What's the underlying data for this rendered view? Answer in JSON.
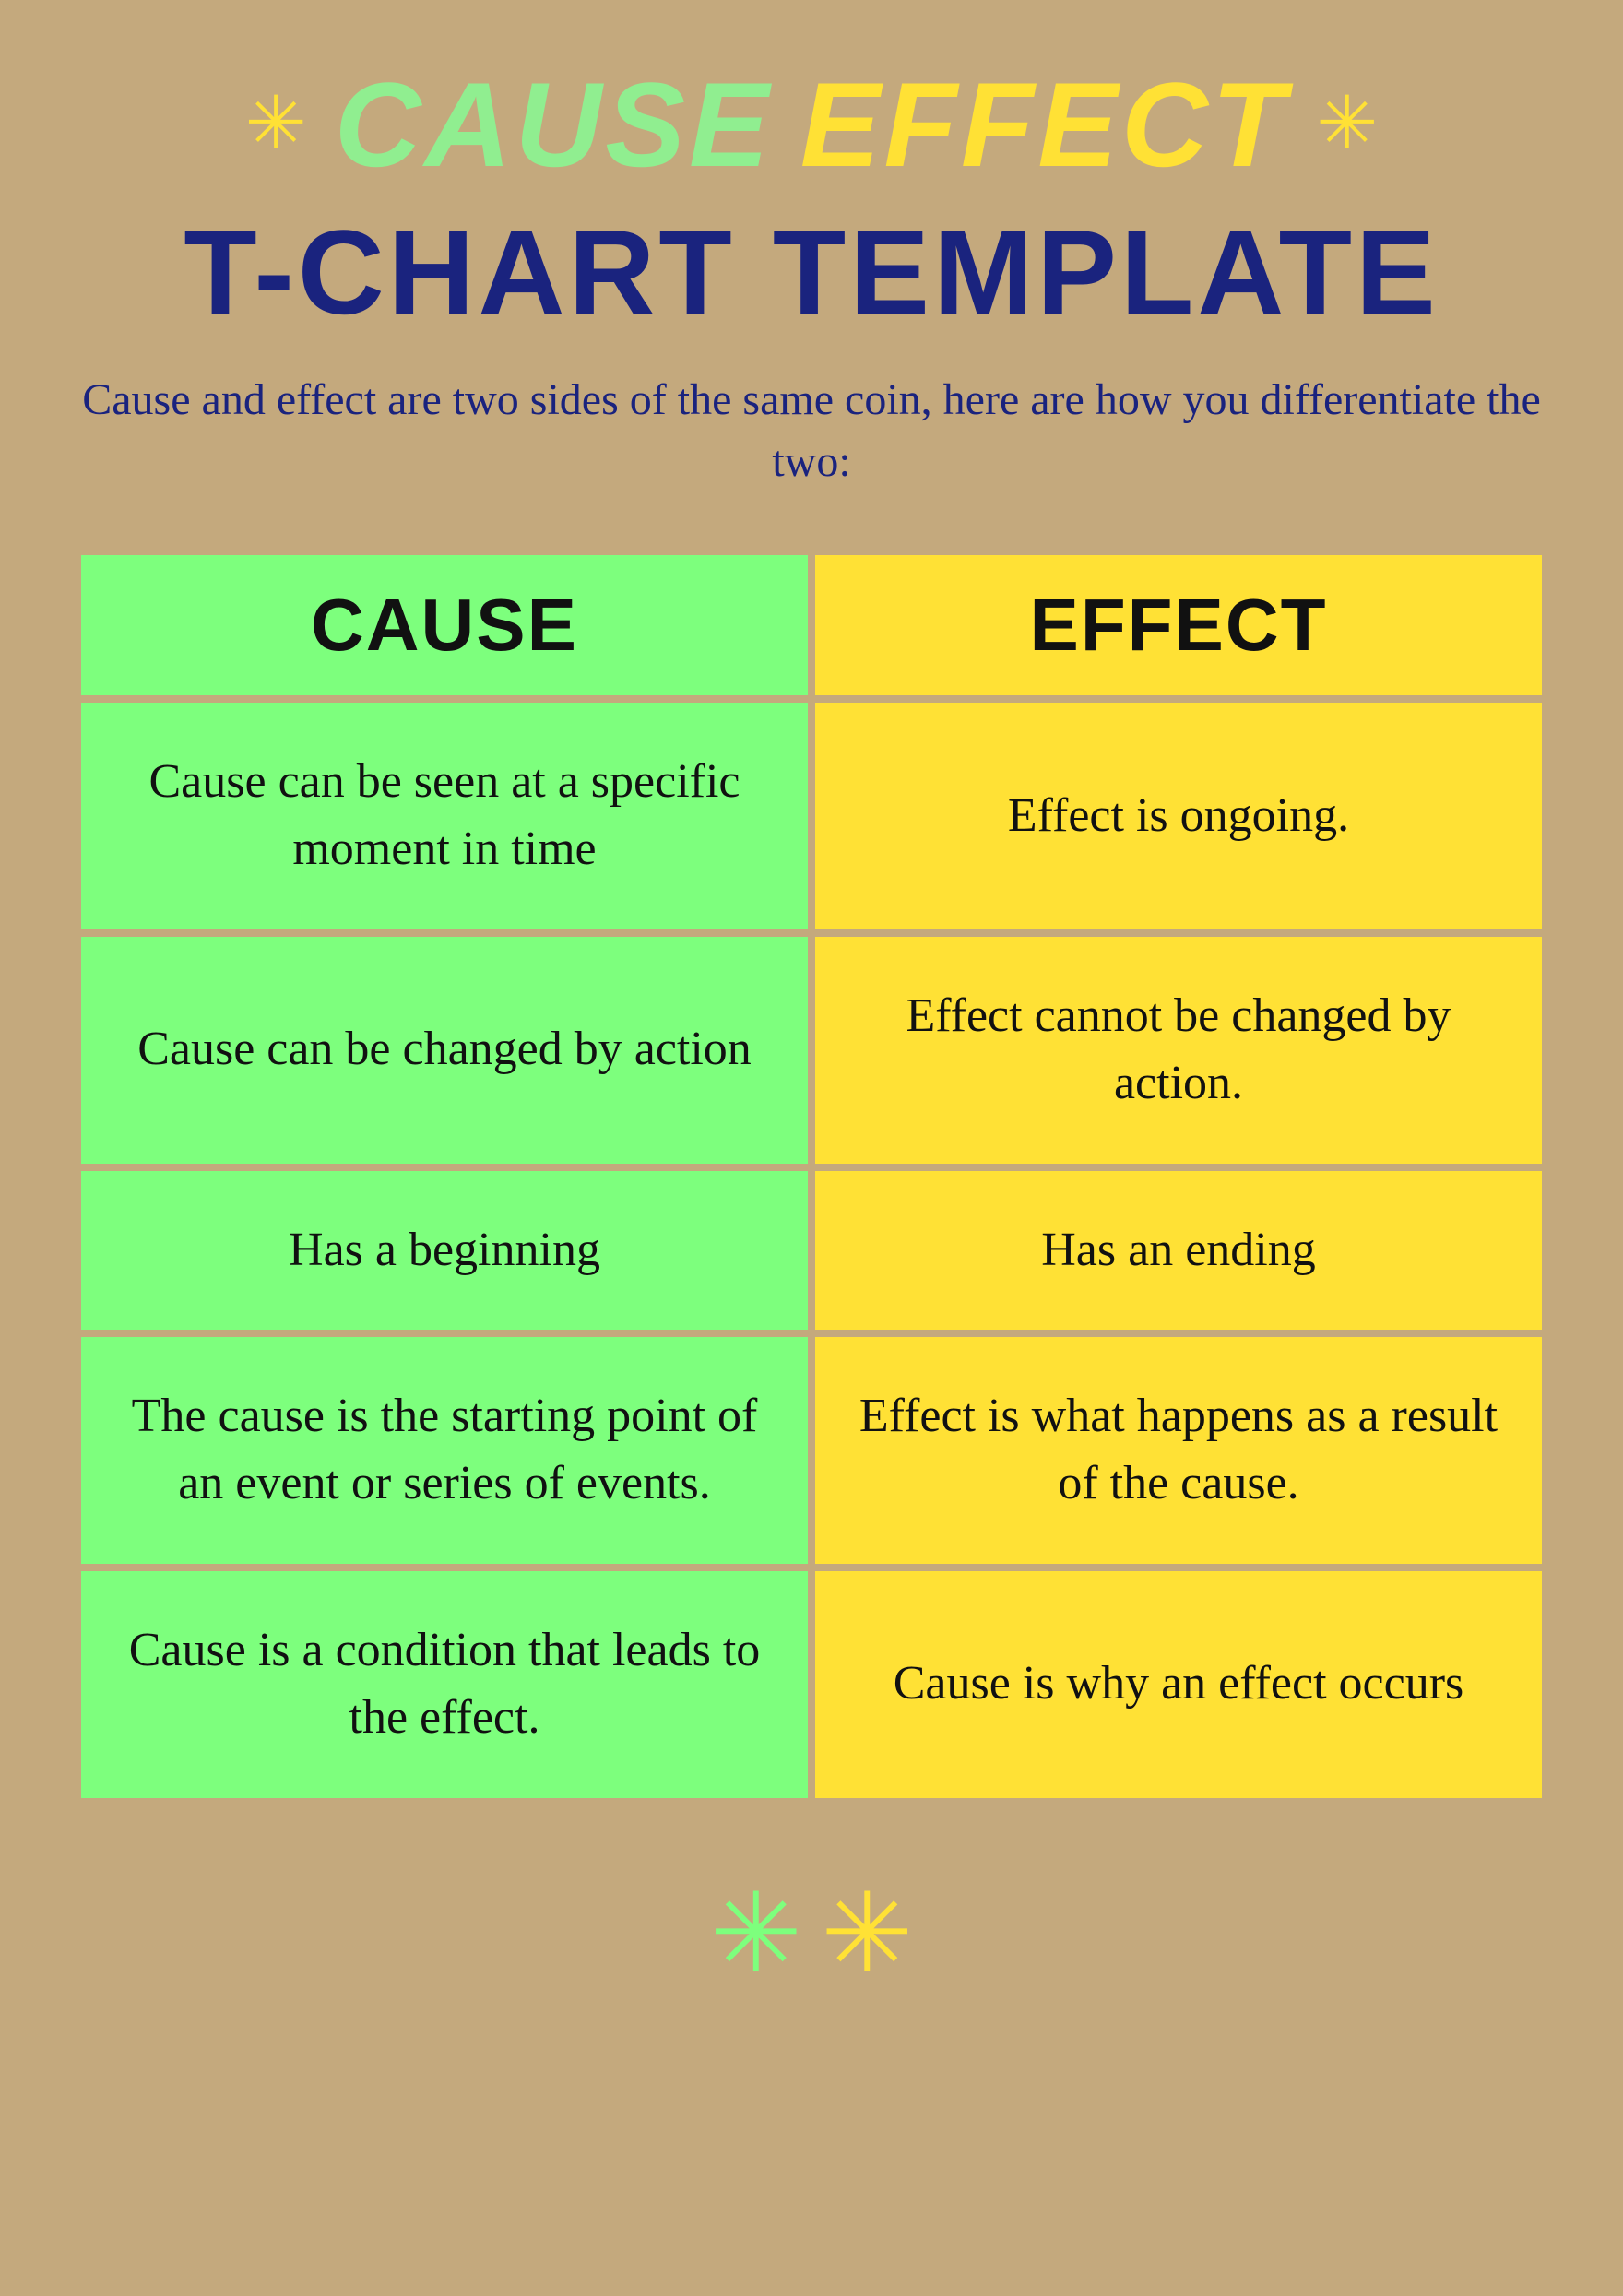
{
  "header": {
    "title_cause": "CAUSE",
    "title_effect": "EFFECT",
    "title_line2": "T-CHART TEMPLATE",
    "subtitle": "Cause and effect are two sides of the same coin, here are how you differentiate the two:",
    "star_symbol": "✳"
  },
  "table": {
    "col_cause_header": "CAUSE",
    "col_effect_header": "EFFECT",
    "rows": [
      {
        "cause": "Cause can be seen at a specific moment in time",
        "effect": "Effect is ongoing."
      },
      {
        "cause": "Cause can be changed by action",
        "effect": "Effect cannot be changed by action."
      },
      {
        "cause": "Has a beginning",
        "effect": "Has an ending"
      },
      {
        "cause": "The cause is the starting point of an event or series of events.",
        "effect": "Effect is what happens as a result of the cause."
      },
      {
        "cause": "Cause is a condition that leads to the effect.",
        "effect": "Cause is why an effect occurs"
      }
    ]
  },
  "colors": {
    "background": "#C4A97D",
    "cause_bg": "#7DFF7D",
    "effect_bg": "#FFE135",
    "title_cause_color": "#90EE90",
    "title_effect_color": "#FFE135",
    "title_line2_color": "#1a237e",
    "subtitle_color": "#1a237e",
    "star_color_yellow": "#FFE135",
    "star_color_green": "#7DFF7D"
  }
}
